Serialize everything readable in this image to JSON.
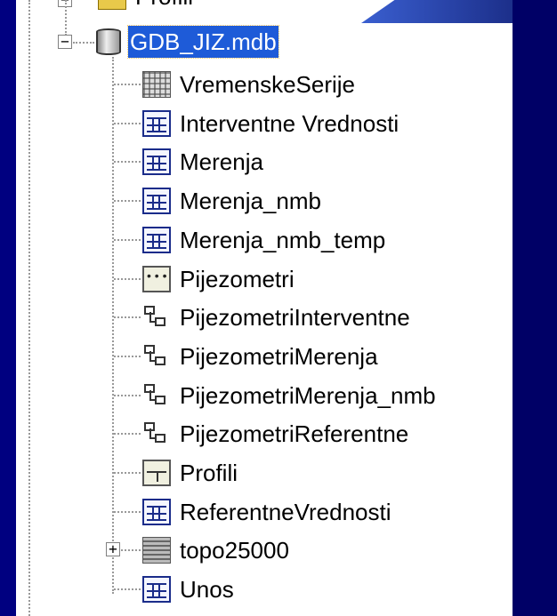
{
  "tree": {
    "root_partial_label": "Profili",
    "database": {
      "label": "GDB_JIZ.mdb",
      "expander": "−",
      "icon": "database-icon"
    },
    "items": [
      {
        "label": "VremenskeSerije",
        "icon": "raster-catalog-icon"
      },
      {
        "label": "Interventne Vrednosti",
        "icon": "table-icon"
      },
      {
        "label": "Merenja",
        "icon": "table-icon"
      },
      {
        "label": "Merenja_nmb",
        "icon": "table-icon"
      },
      {
        "label": "Merenja_nmb_temp",
        "icon": "table-icon"
      },
      {
        "label": "Pijezometri",
        "icon": "point-feature-class-icon"
      },
      {
        "label": "PijezometriInterventne",
        "icon": "relationship-class-icon"
      },
      {
        "label": "PijezometriMerenja",
        "icon": "relationship-class-icon"
      },
      {
        "label": "PijezometriMerenja_nmb",
        "icon": "relationship-class-icon"
      },
      {
        "label": "PijezometriReferentne",
        "icon": "relationship-class-icon"
      },
      {
        "label": "Profili",
        "icon": "line-feature-class-icon"
      },
      {
        "label": "ReferentneVrednosti",
        "icon": "table-icon"
      },
      {
        "label": "topo25000",
        "icon": "raster-dataset-icon",
        "expander": "+"
      },
      {
        "label": "Unos",
        "icon": "table-icon"
      }
    ]
  },
  "colors": {
    "background": "#000066",
    "selection": "#1e5bd8",
    "panel": "#ffffff"
  }
}
